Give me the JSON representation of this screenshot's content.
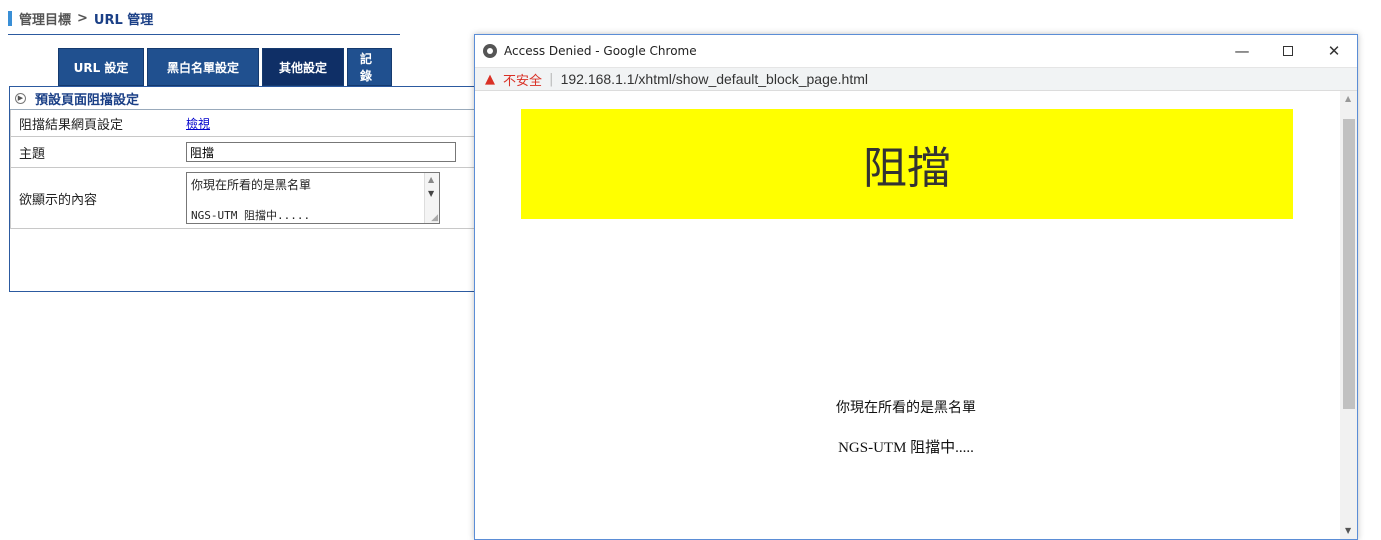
{
  "breadcrumb": {
    "root": "管理目標",
    "separator": ">",
    "current": "URL 管理"
  },
  "tabs": [
    {
      "label": "URL 設定",
      "active": false
    },
    {
      "label": "黑白名單設定",
      "active": false
    },
    {
      "label": "其他設定",
      "active": true
    },
    {
      "label": "記錄",
      "active": false
    }
  ],
  "panel": {
    "title": "預設頁面阻擋設定",
    "rows": {
      "result_page": {
        "label": "阻擋結果網頁設定",
        "link": "檢視"
      },
      "subject": {
        "label": "主題",
        "value": "阻擋"
      },
      "content": {
        "label": "欲顯示的內容",
        "line1": "你現在所看的是黑名單",
        "line2": "NGS-UTM 阻擋中....."
      }
    }
  },
  "popup": {
    "window_title": "Access Denied - Google Chrome",
    "controls": {
      "minimize": "—",
      "close": "✕"
    },
    "address": {
      "warning": "不安全",
      "url": "192.168.1.1/xhtml/show_default_block_page.html"
    },
    "page": {
      "banner": "阻擋",
      "banner_color": "#ffff00",
      "line1": "你現在所看的是黑名單",
      "line2": "NGS-UTM 阻擋中....."
    }
  },
  "colors": {
    "accent": "#20508f",
    "active_tab": "#0f2f66",
    "link": "#0000cc",
    "warning": "#d93025"
  }
}
